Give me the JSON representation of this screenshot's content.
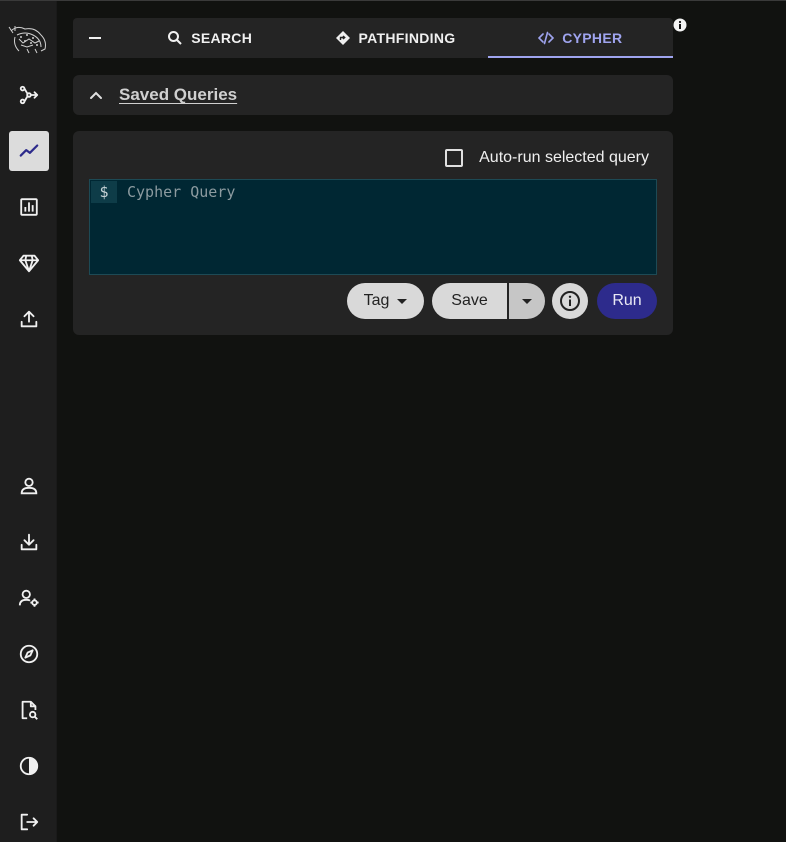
{
  "sidebar": {
    "top_items": [
      {
        "name": "explore",
        "icon": "graph-branch-icon"
      },
      {
        "name": "cypher-graph",
        "icon": "trend-line-icon",
        "active": true
      },
      {
        "name": "reports",
        "icon": "bar-chart-icon"
      },
      {
        "name": "tiers",
        "icon": "gem-icon"
      },
      {
        "name": "upload",
        "icon": "upload-icon"
      }
    ],
    "bottom_items": [
      {
        "name": "profile",
        "icon": "user-icon"
      },
      {
        "name": "download",
        "icon": "download-icon"
      },
      {
        "name": "admin",
        "icon": "user-gear-icon"
      },
      {
        "name": "explore-compass",
        "icon": "compass-icon"
      },
      {
        "name": "docs",
        "icon": "file-search-icon"
      },
      {
        "name": "theme",
        "icon": "contrast-icon"
      },
      {
        "name": "logout",
        "icon": "logout-icon"
      }
    ]
  },
  "tabs": {
    "collapse_icon": "minus-icon",
    "items": [
      {
        "label": "SEARCH",
        "icon": "search-icon"
      },
      {
        "label": "PATHFINDING",
        "icon": "directions-icon"
      },
      {
        "label": "CYPHER",
        "icon": "code-icon",
        "active": true
      }
    ]
  },
  "saved_queries": {
    "title": "Saved Queries",
    "icon": "chevron-up-icon"
  },
  "query": {
    "autorun_label": "Auto-run selected query",
    "autorun_checked": false,
    "prompt": "$",
    "placeholder": "Cypher Query",
    "tag_label": "Tag",
    "save_label": "Save",
    "run_label": "Run"
  },
  "colors": {
    "accent": "#9fa4ef",
    "run_button": "#2d2b8c",
    "editor_bg": "#002733",
    "panel_bg": "#242424",
    "page_bg": "#111210"
  }
}
